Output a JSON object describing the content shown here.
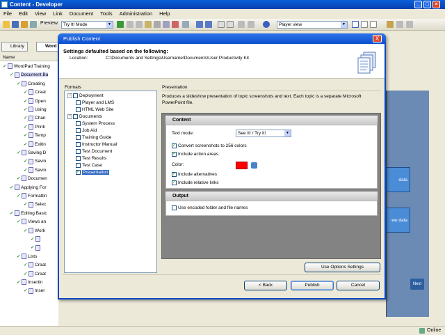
{
  "app": {
    "title": "Content - Developer",
    "menu": [
      "File",
      "Edit",
      "View",
      "Link",
      "Document",
      "Tools",
      "Administration",
      "Help"
    ],
    "toolbar": {
      "preview_label": "Preview:",
      "preview_value": "Try It! Mode",
      "view_value": "Player view"
    },
    "left_tabs": [
      "Library",
      "Word"
    ],
    "name_header": "Name",
    "tree": [
      {
        "label": "WordPad Training",
        "level": 0
      },
      {
        "label": "Document Ba",
        "level": 1,
        "selected": true
      },
      {
        "label": "Creating",
        "level": 2
      },
      {
        "label": "Creat",
        "level": 3
      },
      {
        "label": "Open",
        "level": 3
      },
      {
        "label": "Using",
        "level": 3
      },
      {
        "label": "Chan",
        "level": 3
      },
      {
        "label": "Printi",
        "level": 3
      },
      {
        "label": "Temp",
        "level": 3
      },
      {
        "label": "Exitin",
        "level": 3
      },
      {
        "label": "Saving D",
        "level": 2
      },
      {
        "label": "Savin",
        "level": 3
      },
      {
        "label": "Savin",
        "level": 3
      },
      {
        "label": "Documen",
        "level": 2
      },
      {
        "label": "Applying For",
        "level": 1
      },
      {
        "label": "Formattin",
        "level": 2
      },
      {
        "label": "Selec",
        "level": 3
      },
      {
        "label": "Editing Basic",
        "level": 1
      },
      {
        "label": "Views an",
        "level": 2
      },
      {
        "label": "Work",
        "level": 3
      },
      {
        "label": "",
        "level": 4
      },
      {
        "label": "",
        "level": 4
      },
      {
        "label": "Lists",
        "level": 2
      },
      {
        "label": "Creat",
        "level": 3
      },
      {
        "label": "Creat",
        "level": 3
      },
      {
        "label": "Insertin",
        "level": 2
      },
      {
        "label": "Inser",
        "level": 3
      }
    ],
    "slide_boxes": [
      "data",
      "ew data"
    ],
    "next_label": "Next",
    "status": "Online"
  },
  "dialog": {
    "title": "Publish Content",
    "close_label": "X",
    "header_title": "Settings defaulted based on the following:",
    "location_label": "Location:",
    "location_value": "C:\\Documents and Settings\\Username\\Documents\\User Productivity Kit",
    "formats_label": "Formats",
    "presentation_label": "Presentation",
    "formats": [
      {
        "label": "Deployment",
        "level": 0,
        "group": true
      },
      {
        "label": "Player and LMS",
        "level": 1,
        "checked": false
      },
      {
        "label": "HTML Web Site",
        "level": 1,
        "checked": false
      },
      {
        "label": "Documents",
        "level": 0,
        "group": true
      },
      {
        "label": "System Process",
        "level": 1,
        "checked": false
      },
      {
        "label": "Job Aid",
        "level": 1,
        "checked": false
      },
      {
        "label": "Training Guide",
        "level": 1,
        "checked": false
      },
      {
        "label": "Instructor Manual",
        "level": 1,
        "checked": false
      },
      {
        "label": "Test Document",
        "level": 1,
        "checked": false
      },
      {
        "label": "Test Results",
        "level": 1,
        "checked": false
      },
      {
        "label": "Test Case",
        "level": 1,
        "checked": false
      },
      {
        "label": "Presentation",
        "level": 1,
        "checked": true,
        "selected": true
      }
    ],
    "description": "Produces a slideshow presentation of topic screenshots and text.  Each topic is a separate Microsoft PowerPoint file.",
    "content_section": {
      "title": "Content",
      "text_mode_label": "Text mode:",
      "text_mode_value": "See It! / Try It!",
      "convert_label": "Convert screenshots to 256 colors",
      "action_areas_label": "Include action areas",
      "color_label": "Color:",
      "color_value": "#ff0000",
      "alternatives_label": "Include alternatives",
      "relative_links_label": "Include relative links"
    },
    "output_section": {
      "title": "Output",
      "encoded_label": "Use encoded folder and file names"
    },
    "use_options_button": "Use Options Settings",
    "back_button": "< Back",
    "publish_button": "Publish",
    "cancel_button": "Cancel"
  }
}
